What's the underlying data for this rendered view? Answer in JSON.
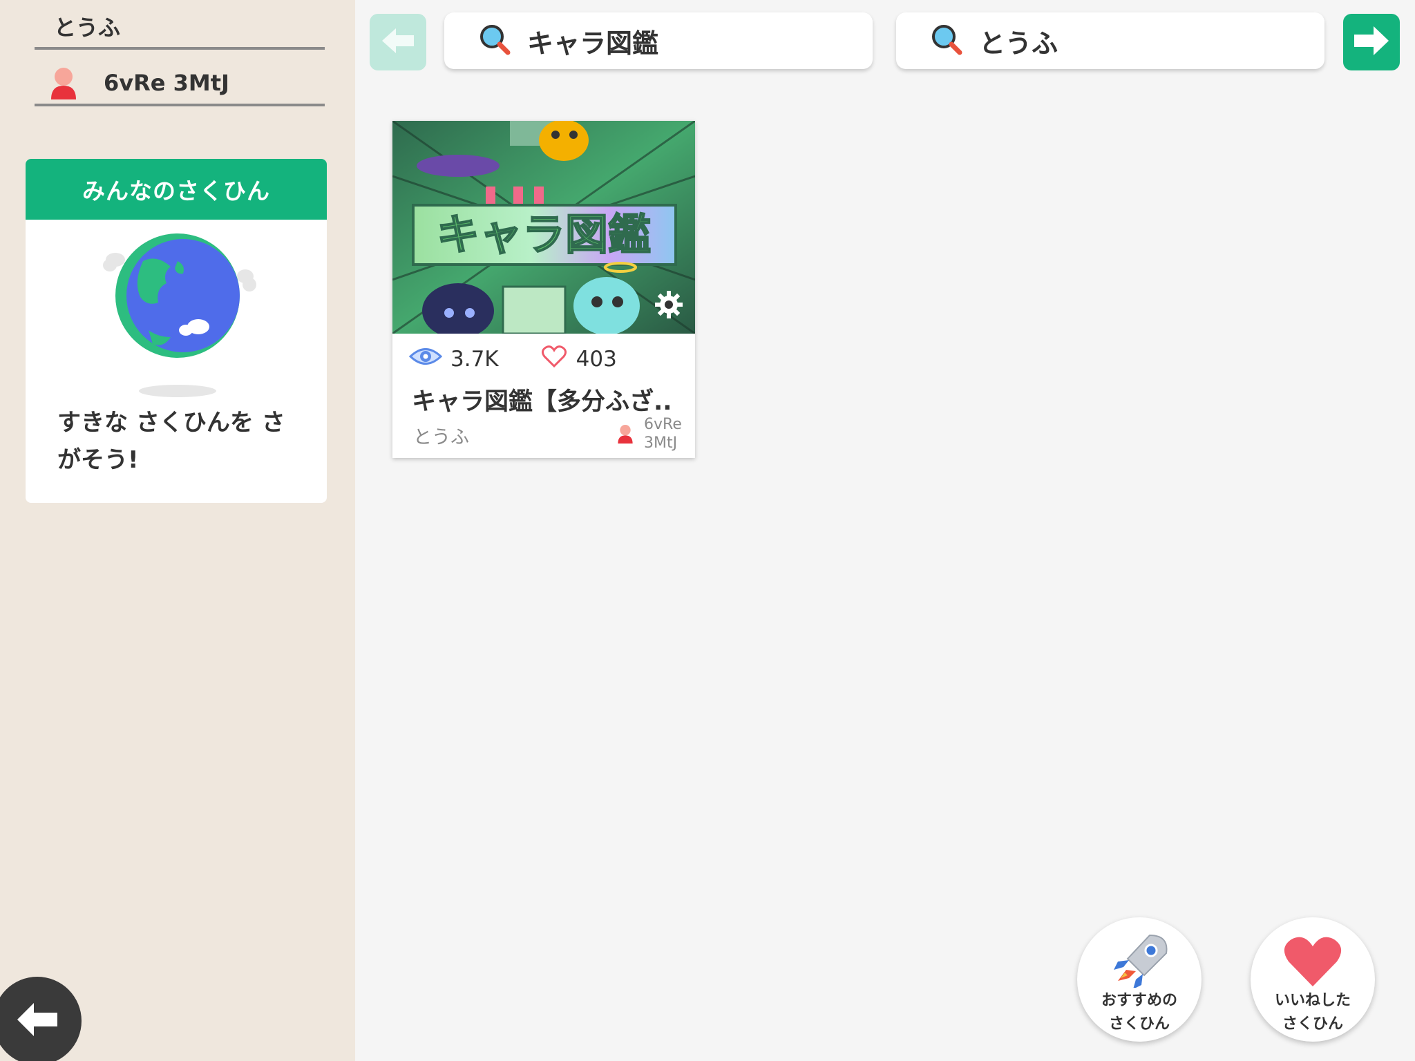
{
  "sidebar": {
    "title": "とうふ",
    "user_name": "6vRe 3MtJ",
    "panel": {
      "header": "みんなのさくひん",
      "text": "すきな さくひんを さがそう!"
    }
  },
  "topbar": {
    "search_work_value": "キャラ図鑑",
    "search_author_value": "とうふ"
  },
  "card": {
    "thumbnail_text": "キャラ図鑑",
    "views": "3.7K",
    "likes": "403",
    "title": "キャラ図鑑【多分ふざ..",
    "author": "とうふ",
    "user_name": "6vRe 3MtJ"
  },
  "fabs": {
    "recommended_label": "おすすめの\nさくひん",
    "liked_label": "いいねした\nさくひん"
  },
  "colors": {
    "accent_green": "#14b37d",
    "sidebar_bg": "#efe7dd",
    "heart_red": "#f05a6a"
  },
  "icons": [
    "person-icon",
    "globe-icon",
    "arrow-left-icon",
    "search-icon",
    "arrow-right-icon",
    "eye-icon",
    "heart-icon",
    "gear-icon",
    "rocket-icon"
  ]
}
